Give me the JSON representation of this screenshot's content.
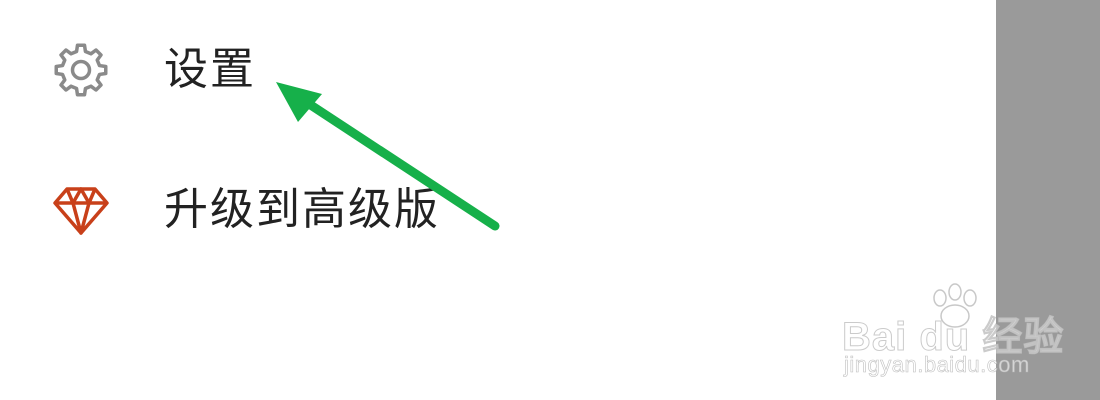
{
  "menu": {
    "items": [
      {
        "label": "设置",
        "icon": "gear-icon"
      },
      {
        "label": "升级到高级版",
        "icon": "diamond-icon"
      }
    ]
  },
  "watermark": {
    "brand": "Bai du 经验",
    "url": "jingyan.baidu.com"
  },
  "colors": {
    "gear_icon": "#8a8a8a",
    "diamond_icon": "#c8401a",
    "arrow": "#16b04a",
    "side_panel": "#9a9a9a",
    "label_text": "#222222"
  }
}
